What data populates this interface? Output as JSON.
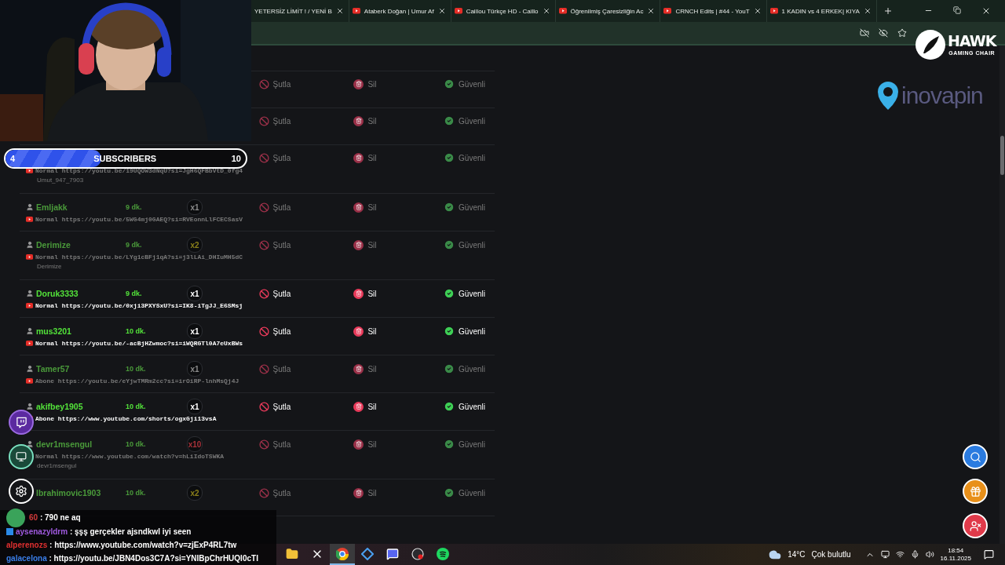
{
  "browser": {
    "tabs": [
      {
        "title": "YETERSİZ LİMİT ! / YENİ B",
        "youtube": false
      },
      {
        "title": "Ataberk Doğan | Umur Af",
        "youtube": true
      },
      {
        "title": "Caillou Türkçe HD - Caillo",
        "youtube": true
      },
      {
        "title": "Öğrenilmiş Çaresizliğin Ac",
        "youtube": true
      },
      {
        "title": "CRNCH Edits | #44 - YouT",
        "youtube": true
      },
      {
        "title": "1 KADIN vs 4 ERKEK| KIYA",
        "youtube": true
      }
    ]
  },
  "subscriber_goal": {
    "current": "4",
    "label": "SUBSCRIBERS",
    "target": "10",
    "level": 0.4
  },
  "queue": {
    "rows": [
      {
        "dimmed": true,
        "actions": [
          "Şutla",
          "Sil",
          "Güvenli"
        ]
      },
      {
        "dimmed": true,
        "actions": [
          "Şutla",
          "Sil",
          "Güvenli"
        ]
      },
      {
        "dimmed": true,
        "source": "Normal",
        "url": "https://youtu.be/19UQOW3dNqU?si=JgH6QFBbVtD_0fg4",
        "note": "Umut_947_7903",
        "actions": [
          "Şutla",
          "Sil",
          "Güvenli"
        ]
      },
      {
        "dimmed": true,
        "user": "Emljakk",
        "time": "9 dk.",
        "count": {
          "text": "x1",
          "color": "#8a8a8a"
        },
        "source": "Normal",
        "url": "https://youtu.be/5WG4mj0GAEQ?si=RVEonnLlFCECSasV",
        "actions": [
          "Şutla",
          "Sil",
          "Güvenli"
        ]
      },
      {
        "dimmed": true,
        "user": "Derimize",
        "time": "9 dk.",
        "count": {
          "text": "x2",
          "color": "#8a7f1a"
        },
        "source": "Normal",
        "url": "https://youtu.be/LYg1cBFj1qA?si=j3lLAi_DHIuMH5dC",
        "note": "Derimize",
        "actions": [
          "Şutla",
          "Sil",
          "Güvenli"
        ]
      },
      {
        "dimmed": false,
        "user": "Doruk3333",
        "time": "9 dk.",
        "count": {
          "text": "x1",
          "color": "#ffffff"
        },
        "source": "Normal",
        "url": "https://youtu.be/0xji3PXYSxU?si=IK8-iTgJJ_E6SMsj",
        "actions": [
          "Şutla",
          "Sil",
          "Güvenli"
        ]
      },
      {
        "dimmed": false,
        "user": "mus3201",
        "time": "10 dk.",
        "count": {
          "text": "x1",
          "color": "#ffffff"
        },
        "source": "Normal",
        "url": "https://youtu.be/-acBjHZwmoc?si=iWQRGTl0A7eUxBWs",
        "actions": [
          "Şutla",
          "Sil",
          "Güvenli"
        ]
      },
      {
        "dimmed": true,
        "user": "Tamer57",
        "time": "10 dk.",
        "count": {
          "text": "x1",
          "color": "#8a8a8a"
        },
        "source": "Abone",
        "url": "https://youtu.be/eYjwTMRm2cc?si=irOiRP-lnhMsQj4J",
        "actions": [
          "Şutla",
          "Sil",
          "Güvenli"
        ]
      },
      {
        "dimmed": false,
        "user": "akifbey1905",
        "time": "10 dk.",
        "count": {
          "text": "x1",
          "color": "#ffffff"
        },
        "source": "Abone",
        "url": "https://www.youtube.com/shorts/ogxGji13vsA",
        "actions": [
          "Şutla",
          "Sil",
          "Güvenli"
        ]
      },
      {
        "dimmed": true,
        "user": "devr1msengul",
        "time": "10 dk.",
        "count": {
          "text": "x10",
          "color": "#a8323a"
        },
        "source": "Normal",
        "url": "https://www.youtube.com/watch?v=hLiIdoTSWKA",
        "note": "devr1msengul",
        "actions": [
          "Şutla",
          "Sil",
          "Güvenli"
        ]
      },
      {
        "dimmed": true,
        "user": "Ibrahimovic1903",
        "time": "10 dk.",
        "count": {
          "text": "x2",
          "color": "#8a7f1a"
        },
        "actions": [
          "Şutla",
          "Sil",
          "Güvenli"
        ]
      }
    ]
  },
  "sponsors": {
    "hawk_name": "HAWK",
    "hawk_tagline": "GAMING CHAIR",
    "pin_name": "inovapin"
  },
  "chat": [
    {
      "kind": "avatar",
      "user": "60",
      "color": "#d23a3a",
      "message": ": 790 ne aq"
    },
    {
      "kind": "badge",
      "user": "aysenazyldrm",
      "color": "#a05ae0",
      "message": ": şşş gerçekler ajsndkwl iyi seen"
    },
    {
      "kind": "plain",
      "user": "alperenozs",
      "color": "#e03030",
      "message": ": https://www.youtube.com/watch?v=zjExP4RL7tw"
    },
    {
      "kind": "plain",
      "user": "galacelona",
      "color": "#3a7ee8",
      "message": ": https://youtu.be/JBN4Dos3C7A?si=YNIBpChrHUQI0cTI"
    }
  ],
  "taskbar": {
    "apps": [
      {
        "kind": "folder",
        "selected": false
      },
      {
        "kind": "tool",
        "selected": false
      },
      {
        "kind": "browser",
        "selected": true
      },
      {
        "kind": "diamond",
        "selected": false
      },
      {
        "kind": "chat",
        "selected": false
      },
      {
        "kind": "record",
        "selected": false
      },
      {
        "kind": "music",
        "selected": false
      }
    ],
    "temperature": "14°C",
    "condition": "Çok bulutlu",
    "time": "18:54",
    "date": "16.11.2025"
  }
}
